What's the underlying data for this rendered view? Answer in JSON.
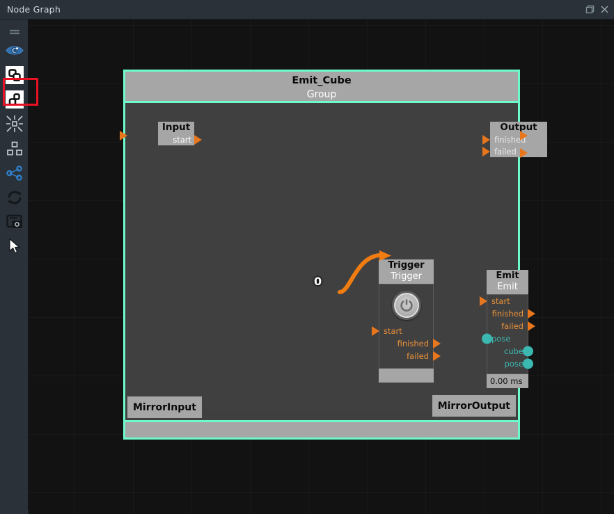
{
  "window": {
    "title": "Node Graph",
    "buttons": [
      {
        "name": "float-window-icon",
        "label": ""
      },
      {
        "name": "close-icon",
        "label": ""
      }
    ]
  },
  "toolbar": {
    "items": [
      {
        "name": "menu-handle-icon",
        "label": "menu-handle",
        "selected": false
      },
      {
        "name": "eye-icon",
        "label": "visibility",
        "selected": false
      },
      {
        "name": "group-nodes-icon",
        "label": "group-nodes",
        "selected": false
      },
      {
        "name": "ungroup-nodes-icon",
        "label": "ungroup-nodes",
        "selected": true
      },
      {
        "name": "collapse-icon",
        "label": "collapse",
        "selected": false
      },
      {
        "name": "layout-hierarchy-icon",
        "label": "layout-hierarchy",
        "selected": false
      },
      {
        "name": "share-graph-icon",
        "label": "share-graph",
        "selected": false
      },
      {
        "name": "refresh-icon",
        "label": "refresh",
        "selected": false
      },
      {
        "name": "screenshot-icon",
        "label": "screenshot",
        "selected": false
      },
      {
        "name": "cursor-icon",
        "label": "select-tool",
        "selected": false
      }
    ]
  },
  "colors": {
    "group_border": "#6dfacb",
    "exec_port": "#e8761d",
    "exec_label": "#e8903a",
    "data_port": "#3bb8b0",
    "node_header": "#a6a6a6",
    "node_body": "#404040",
    "canvas_bg": "#121212",
    "selection_highlight": "#e81123"
  },
  "graph": {
    "group": {
      "title": "Emit_Cube",
      "subtitle": "Group",
      "input_node": {
        "title": "Input",
        "ports": [
          {
            "name": "start",
            "kind": "exec"
          }
        ]
      },
      "output_node": {
        "title": "Output",
        "ports": [
          {
            "name": "finished",
            "kind": "exec"
          },
          {
            "name": "failed",
            "kind": "exec"
          }
        ]
      },
      "mirror_input_label": "MirrorInput",
      "mirror_output_label": "MirrorOutput"
    },
    "nodes": [
      {
        "id": "trigger",
        "title": "Trigger",
        "subtitle": "Trigger",
        "widget": "power-button",
        "inputs_exec": [
          "start"
        ],
        "outputs_exec": [
          "finished",
          "failed"
        ],
        "inputs_data": [],
        "outputs_data": []
      },
      {
        "id": "emit",
        "title": "Emit",
        "subtitle": "Emit",
        "inputs_exec": [
          "start"
        ],
        "outputs_exec": [
          "finished",
          "failed"
        ],
        "inputs_data": [
          "pose"
        ],
        "outputs_data": [
          "cube",
          "pose"
        ],
        "footer_text": "0.00 ms"
      }
    ],
    "edges": [
      {
        "from_node": "trigger",
        "from_port": "finished",
        "to_node": "emit",
        "to_port": "start",
        "label": "0"
      }
    ]
  }
}
